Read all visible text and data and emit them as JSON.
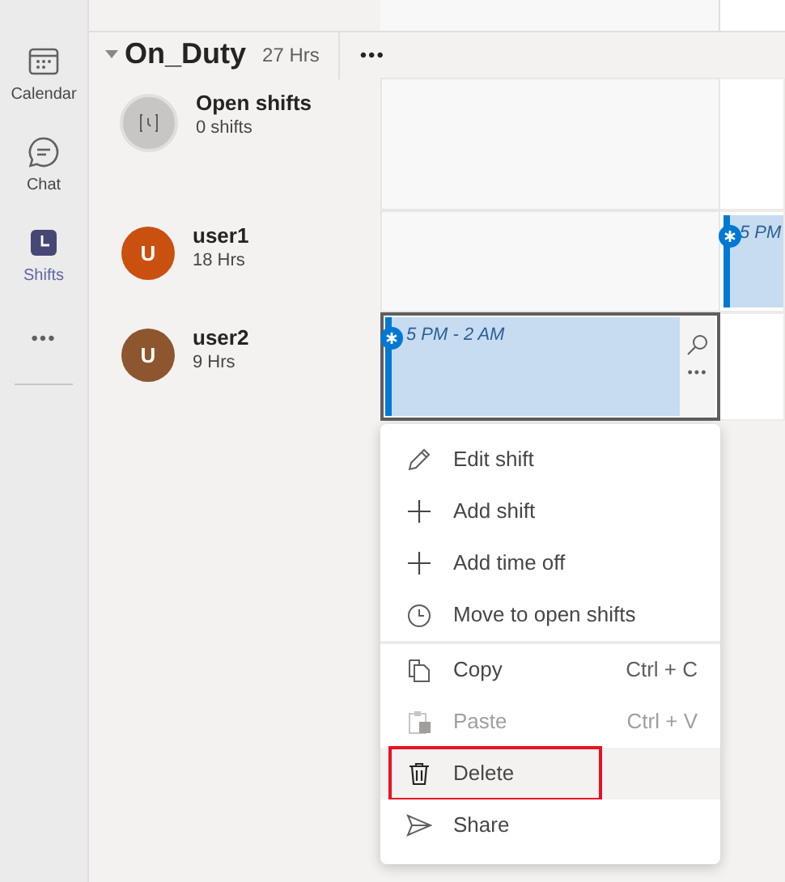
{
  "rail": {
    "items": [
      {
        "label": "Calendar",
        "kind": "calendar",
        "selected": false
      },
      {
        "label": "Chat",
        "kind": "chat",
        "selected": false
      },
      {
        "label": "Shifts",
        "kind": "shifts",
        "selected": true
      }
    ],
    "more": "•••"
  },
  "group": {
    "name": "On_Duty",
    "hours": "27 Hrs",
    "expanded": true,
    "more": "•••"
  },
  "rows": [
    {
      "kind": "open",
      "name": "Open shifts",
      "detail": "0 shifts",
      "cells": [
        {
          "selected": false
        },
        {
          "selected": false
        }
      ]
    },
    {
      "kind": "user",
      "initial": "U",
      "color": "#ca5010",
      "name": "user1",
      "detail": "18 Hrs",
      "cells": [
        {
          "selected": false
        },
        {
          "shift": "5 PM",
          "selected": false
        }
      ]
    },
    {
      "kind": "user",
      "initial": "U",
      "color": "#8e562e",
      "name": "user2",
      "detail": "9 Hrs",
      "cells": [
        {
          "shift": "5 PM - 2 AM",
          "selected": true
        },
        {
          "selected": false
        }
      ]
    }
  ],
  "context_menu": {
    "items": [
      {
        "kind": "edit",
        "label": "Edit shift",
        "disabled": false,
        "hovered": false,
        "outlined": false,
        "divider_after": false
      },
      {
        "kind": "add",
        "label": "Add shift",
        "disabled": false,
        "hovered": false,
        "outlined": false,
        "divider_after": false
      },
      {
        "kind": "add",
        "label": "Add time off",
        "disabled": false,
        "hovered": false,
        "outlined": false,
        "divider_after": false
      },
      {
        "kind": "clock",
        "label": "Move to open shifts",
        "disabled": false,
        "hovered": false,
        "outlined": false,
        "divider_after": true
      },
      {
        "kind": "copy",
        "label": "Copy",
        "shortcut": "Ctrl + C",
        "disabled": false,
        "hovered": false,
        "outlined": false,
        "divider_after": false
      },
      {
        "kind": "paste",
        "label": "Paste",
        "shortcut": "Ctrl + V",
        "disabled": true,
        "hovered": false,
        "outlined": false,
        "divider_after": false
      },
      {
        "kind": "delete",
        "label": "Delete",
        "disabled": false,
        "hovered": true,
        "outlined": true,
        "divider_after": false
      },
      {
        "kind": "share",
        "label": "Share",
        "disabled": false,
        "hovered": false,
        "outlined": false,
        "divider_after": false
      }
    ]
  }
}
